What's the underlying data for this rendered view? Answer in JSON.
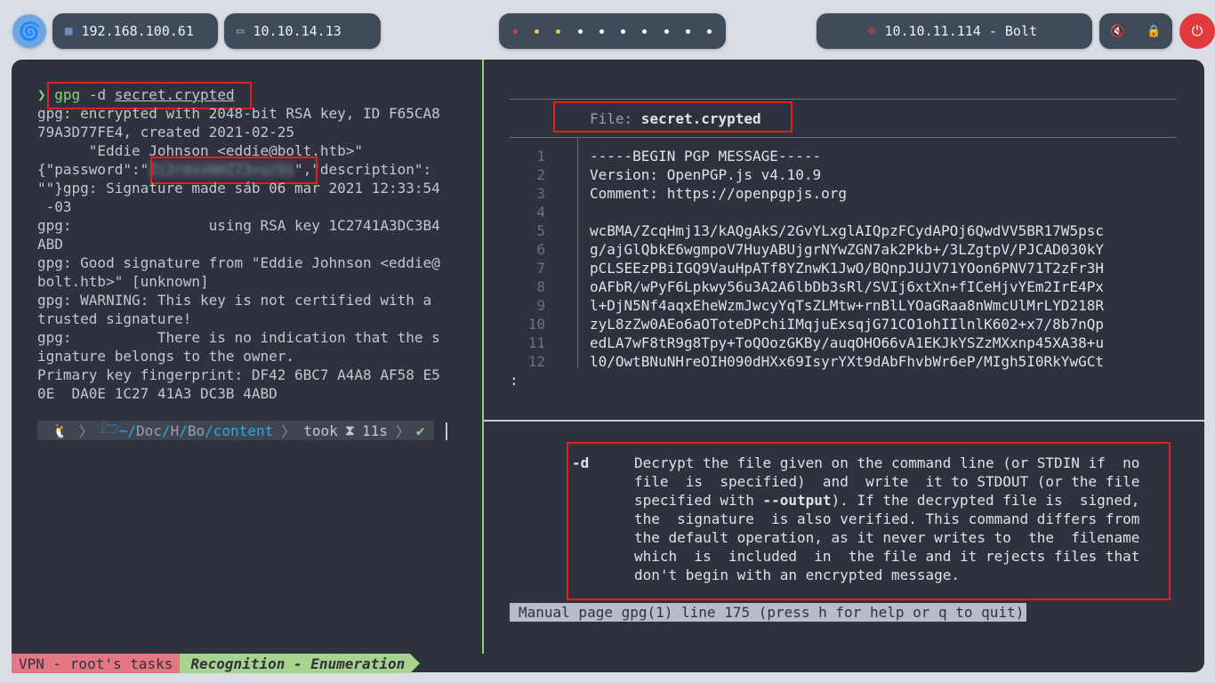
{
  "topbar": {
    "ip_local": "192.168.100.61",
    "ip_vpn": "10.10.14.13",
    "target": "10.10.11.114 - Bolt",
    "workspace_dot_colors": [
      "#e0393e",
      "#f5c242",
      "#f5c242",
      "#ffffff",
      "#ffffff",
      "#ffffff",
      "#ffffff",
      "#ffffff",
      "#ffffff",
      "#ffffff"
    ]
  },
  "terminal": {
    "prompt_symbol": "❯",
    "command": "gpg",
    "command_flag": " -d ",
    "command_arg": "secret.crypted",
    "output": [
      "gpg: encrypted with 2048-bit RSA key, ID F65CA8",
      "79A3D77FE4, created 2021-02-25",
      "      \"Eddie Johnson <eddie@bolt.htb>\""
    ],
    "password_prefix": "{\"password\":\"",
    "password_redacted": "Z(3rmxxNHZ73=u/9s",
    "password_suffix": "\",\"description\":",
    "output2": [
      "\"\"}gpg: Signature made sáb 06 mar 2021 12:33:54",
      " -03",
      "gpg:                using RSA key 1C2741A3DC3B4",
      "ABD",
      "gpg: Good signature from \"Eddie Johnson <eddie@",
      "bolt.htb>\" [unknown]",
      "gpg: WARNING: This key is not certified with a",
      "trusted signature!",
      "gpg:          There is no indication that the s",
      "ignature belongs to the owner.",
      "Primary key fingerprint: DF42 6BC7 A4A8 AF58 E5",
      "0E  DA0E 1C27 41A3 DC3B 4ABD"
    ],
    "prompt_path_prefix": "~/",
    "prompt_path_1": "Doc",
    "prompt_path_2": "H",
    "prompt_path_3": "Bo",
    "prompt_path_4": "content",
    "prompt_took": "took",
    "prompt_time": "11s"
  },
  "viewer": {
    "file_label": "File: ",
    "file_name": "secret.crypted",
    "line_numbers": [
      "1",
      "2",
      "3",
      "4",
      "5",
      "6",
      "7",
      "8",
      "9",
      "10",
      "11",
      "12"
    ],
    "lines": [
      "-----BEGIN PGP MESSAGE-----",
      "Version: OpenPGP.js v4.10.9",
      "Comment: https://openpgpjs.org",
      "",
      "wcBMA/ZcqHmj13/kAQgAkS/2GvYLxglAIQpzFCydAPOj6QwdVV5BR17W5psc",
      "g/ajGlQbkE6wgmpoV7HuyABUjgrNYwZGN7ak2Pkb+/3LZgtpV/PJCAD030kY",
      "pCLSEEzPBiIGQ9VauHpATf8YZnwK1JwO/BQnpJUJV71YOon6PNV71T2zFr3H",
      "oAFbR/wPyF6Lpkwy56u3A2A6lbDb3sRl/SVIj6xtXn+fICeHjvYEm2IrE4Px",
      "l+DjN5Nf4aqxEheWzmJwcyYqTsZLMtw+rnBlLYOaGRaa8nWmcUlMrLYD218R",
      "zyL8zZw0AEo6aOToteDPchiIMqjuExsqjG71CO1ohIIlnlK602+x7/8b7nQp",
      "edLA7wF8tR9g8Tpy+ToQOozGKBy/auqOHO66vA1EKJkYSZzMXxnp45XA38+u",
      "l0/OwtBNuNHreOIH090dHXx69IsyrYXt9dAbFhvbWr6eP/MIgh5I0RkYwGCt"
    ],
    "more_prompt": ":"
  },
  "manpage": {
    "flag": "-d",
    "desc_lines": [
      "Decrypt the file given on the command line (or STDIN if  no",
      "file  is  specified)  and  write  it to STDOUT (or the file",
      "specified with ",
      "the  signature  is also verified. This command differs from",
      "the default operation, as it never writes to  the  filename",
      "which  is  included  in  the file and it rejects files that",
      "don't begin with an encrypted message."
    ],
    "option_ref": "--output",
    "line3_suffix": "). If the decrypted file is  signed,",
    "status": "Manual page gpg(1) line 175 (press h for help or q to quit)"
  },
  "tmux": {
    "session": "VPN - root's tasks",
    "window": "Recognition - Enumeration"
  }
}
